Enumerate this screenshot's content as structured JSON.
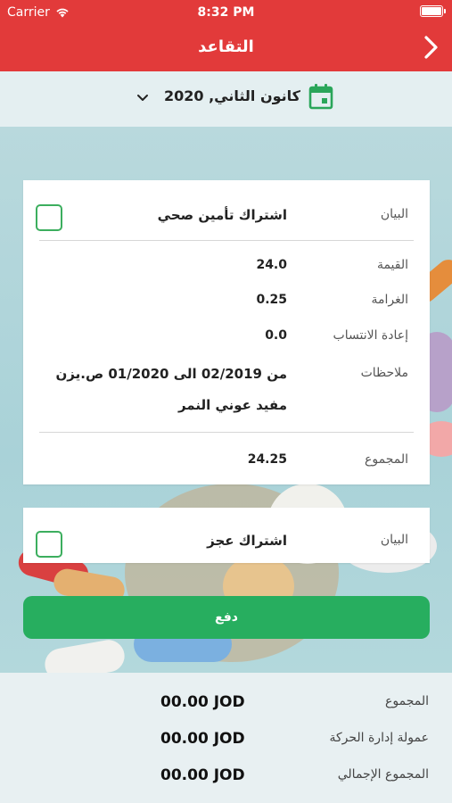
{
  "status": {
    "carrier": "Carrier",
    "time": "8:32 PM"
  },
  "nav": {
    "title": "التقاعد"
  },
  "date_selector": {
    "value": "كانون الثاني, 2020"
  },
  "cards": [
    {
      "statement_label": "البيان",
      "statement_value": "اشتراك تأمين صحي",
      "value_label": "القيمة",
      "value": "24.0",
      "penalty_label": "الغرامة",
      "penalty": "0.25",
      "reaffiliation_label": "إعادة الانتساب",
      "reaffiliation": "0.0",
      "notes_label": "ملاحظات",
      "notes_line1": "من 02/2019 الى 01/2020 ص.يزن",
      "notes_line2": "مفيد عوني النمر",
      "total_label": "المجموع",
      "total": "24.25"
    },
    {
      "statement_label": "البيان",
      "statement_value": "اشتراك عجز"
    }
  ],
  "pay_button": {
    "label": "دفع"
  },
  "totals": {
    "sum_label": "المجموع",
    "sum_value": "00.00 JOD",
    "commission_label": "عمولة إدارة الحركة",
    "commission_value": "00.00 JOD",
    "grand_label": "المجموع الإجمالي",
    "grand_value": "00.00 JOD"
  },
  "colors": {
    "brand_red": "#e23a3a",
    "accent_green": "#27ae5f"
  }
}
